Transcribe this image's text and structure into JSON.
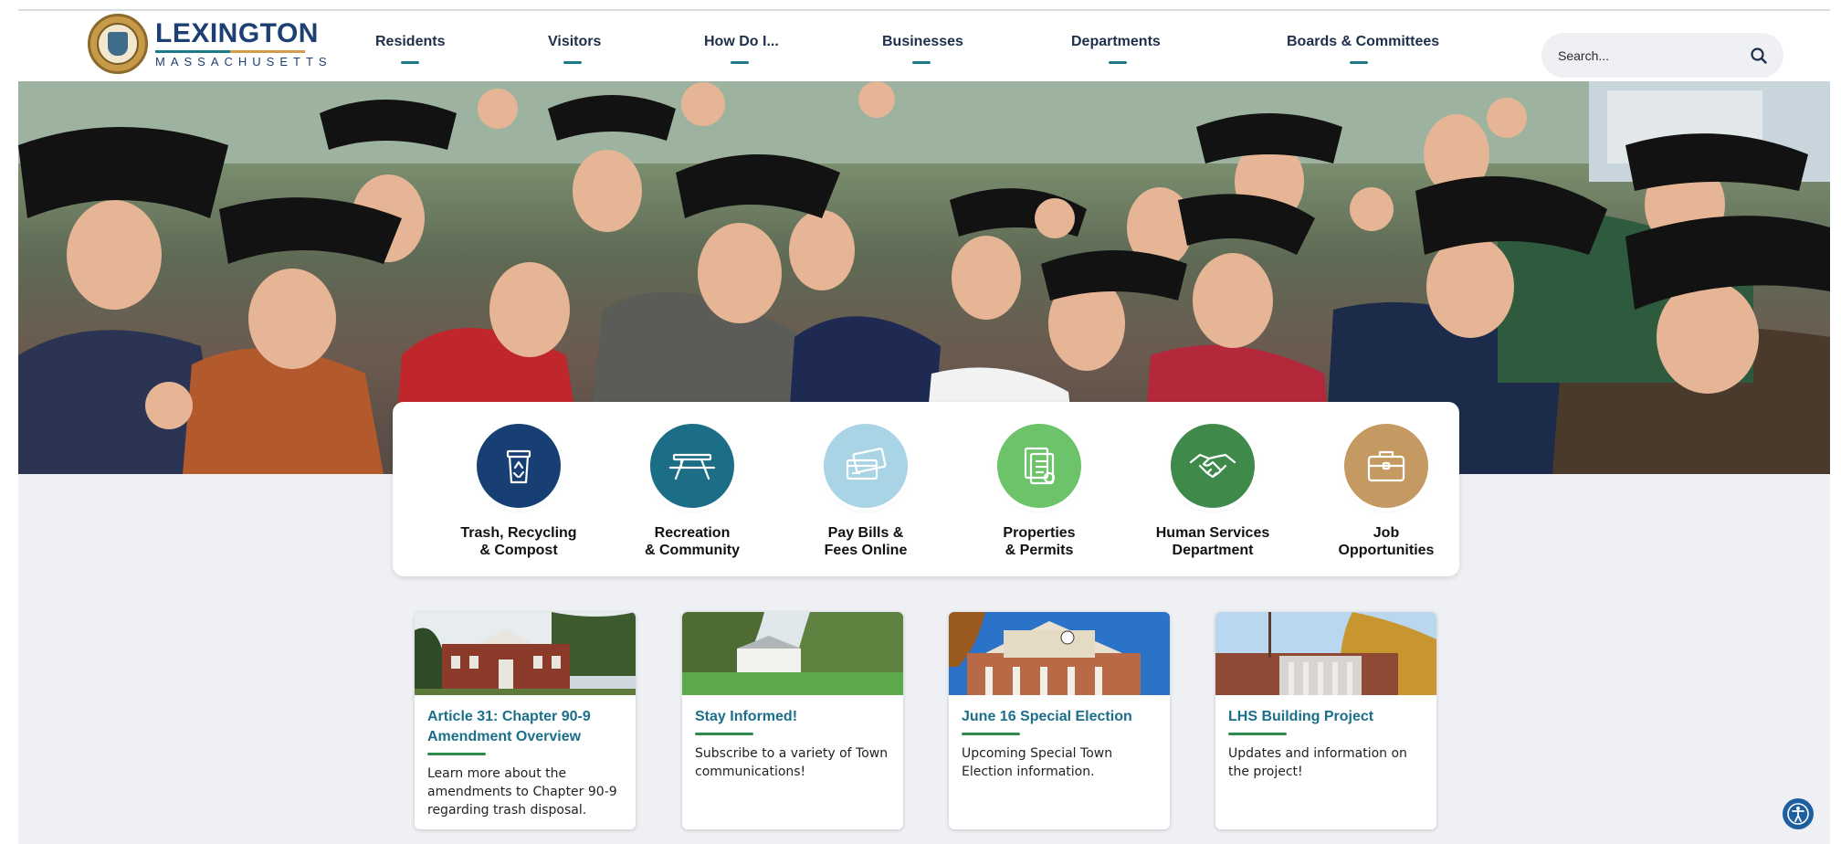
{
  "site": {
    "name": "LEXINGTON",
    "subtitle": "MASSACHUSETTS"
  },
  "nav": [
    {
      "label": "Residents"
    },
    {
      "label": "Visitors"
    },
    {
      "label": "How Do I..."
    },
    {
      "label": "Businesses"
    },
    {
      "label": "Departments"
    },
    {
      "label": "Boards & Committees"
    }
  ],
  "search": {
    "placeholder": "Search..."
  },
  "quick_links": [
    {
      "label": "Trash, Recycling\n& Compost",
      "icon": "recycling-bin-icon",
      "color": "#173f73"
    },
    {
      "label": "Recreation\n& Community",
      "icon": "picnic-table-icon",
      "color": "#1b6e86"
    },
    {
      "label": "Pay Bills &\nFees Online",
      "icon": "credit-cards-icon",
      "color": "#a9d4e6"
    },
    {
      "label": "Properties\n& Permits",
      "icon": "permit-documents-icon",
      "color": "#6cc36a"
    },
    {
      "label": "Human Services\nDepartment",
      "icon": "handshake-icon",
      "color": "#3f8a4a"
    },
    {
      "label": "Job\nOpportunities",
      "icon": "briefcase-icon",
      "color": "#c59a62"
    }
  ],
  "cards": [
    {
      "title": "Article 31: Chapter 90-9 Amendment Overview",
      "description": "Learn more about the amendments to Chapter 90-9 regarding trash disposal."
    },
    {
      "title": "Stay Informed!",
      "description": "Subscribe to a variety of Town communications!"
    },
    {
      "title": "June 16 Special Election",
      "description": "Upcoming Special Town Election information."
    },
    {
      "title": "LHS Building Project",
      "description": "Updates and information on the project!"
    }
  ],
  "colors": {
    "brand_navy": "#1d3f73",
    "accent_teal": "#1b7a86",
    "card_title": "#1b6f8a",
    "card_rule": "#2e8b4d"
  }
}
